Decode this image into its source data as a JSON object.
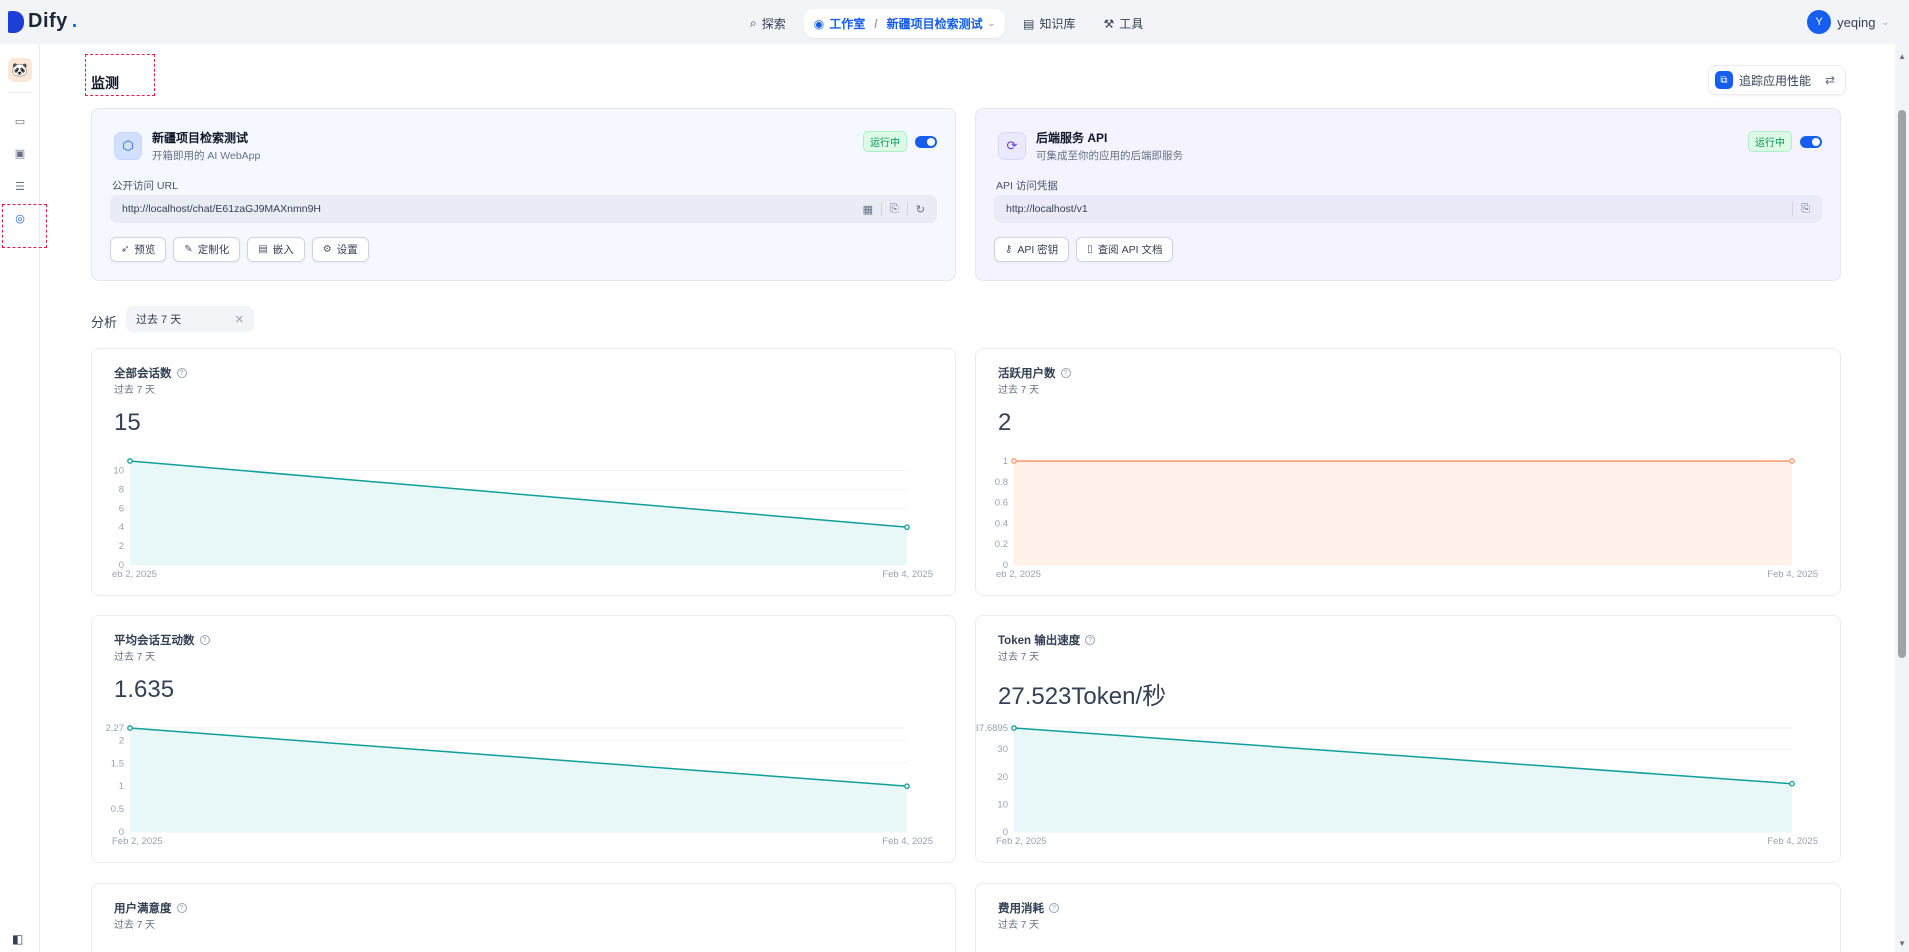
{
  "app": {
    "logo_text": "Dify",
    "logo_dot": "."
  },
  "nav": {
    "explore": "探索",
    "studio": "工作室",
    "separator": "/",
    "current_app": "新疆项目检索测试",
    "knowledge": "知识库",
    "tools": "工具"
  },
  "user": {
    "initial": "Y",
    "name": "yeqing"
  },
  "page": {
    "title": "监测",
    "trace_button": "追踪应用性能"
  },
  "webapp_card": {
    "title": "新疆项目检索测试",
    "subtitle": "开箱即用的 AI WebApp",
    "status": "运行中",
    "url_label": "公开访问 URL",
    "url": "http://localhost/chat/E61zaGJ9MAXnmn9H",
    "buttons": [
      "预览",
      "定制化",
      "嵌入",
      "设置"
    ]
  },
  "api_card": {
    "title": "后端服务 API",
    "subtitle": "可集成至你的应用的后端即服务",
    "status": "运行中",
    "url_label": "API 访问凭据",
    "url": "http://localhost/v1",
    "buttons": [
      "API 密钥",
      "查阅 API 文档"
    ]
  },
  "analysis": {
    "label": "分析",
    "period": "过去 7 天"
  },
  "metrics": [
    {
      "title": "全部会话数",
      "subtitle": "过去 7 天",
      "value": "15",
      "color": "#0e9f9a",
      "fill": "#e6f6f6",
      "chart_data": {
        "type": "area",
        "x": [
          "Feb 2, 2025",
          "Feb 4, 2025"
        ],
        "x_labels": [
          "eb 2, 2025",
          "Feb 4, 2025"
        ],
        "values": [
          11,
          4
        ],
        "yticks": [
          "0",
          "2",
          "4",
          "6",
          "8",
          "10"
        ],
        "ylim": [
          0,
          11
        ]
      }
    },
    {
      "title": "活跃用户数",
      "subtitle": "过去 7 天",
      "value": "2",
      "color": "#f79a6b",
      "fill": "#fff0e8",
      "chart_data": {
        "type": "area",
        "x": [
          "Feb 2, 2025",
          "Feb 4, 2025"
        ],
        "x_labels": [
          "eb 2, 2025",
          "Feb 4, 2025"
        ],
        "values": [
          1,
          1
        ],
        "yticks": [
          "0",
          "0.2",
          "0.4",
          "0.6",
          "0.8",
          "1"
        ],
        "ylim": [
          0,
          1
        ]
      }
    },
    {
      "title": "平均会话互动数",
      "subtitle": "过去 7 天",
      "value": "1.635",
      "color": "#0e9f9a",
      "fill": "#e6f6f6",
      "chart_data": {
        "type": "area",
        "x": [
          "Feb 2, 2025",
          "Feb 4, 2025"
        ],
        "x_labels": [
          "Feb 2, 2025",
          "Feb 4, 2025"
        ],
        "values": [
          2.27,
          1
        ],
        "yticks": [
          "0",
          "0.5",
          "1",
          "1.5",
          "2",
          "2.27"
        ],
        "ylim": [
          0,
          2.27
        ]
      }
    },
    {
      "title": "Token 输出速度",
      "subtitle": "过去 7 天",
      "value": "27.523Token/秒",
      "color": "#0e9f9a",
      "fill": "#e6f6f6",
      "chart_data": {
        "type": "area",
        "x": [
          "Feb 2, 2025",
          "Feb 4, 2025"
        ],
        "x_labels": [
          "Feb 2, 2025",
          "Feb 4, 2025"
        ],
        "values": [
          37.6895,
          17.5
        ],
        "yticks": [
          "0",
          "10",
          "20",
          "30",
          "37.6895"
        ],
        "ylim": [
          0,
          37.6895
        ]
      }
    },
    {
      "title": "用户满意度",
      "subtitle": "过去 7 天"
    },
    {
      "title": "费用消耗",
      "subtitle": "过去 7 天"
    }
  ]
}
